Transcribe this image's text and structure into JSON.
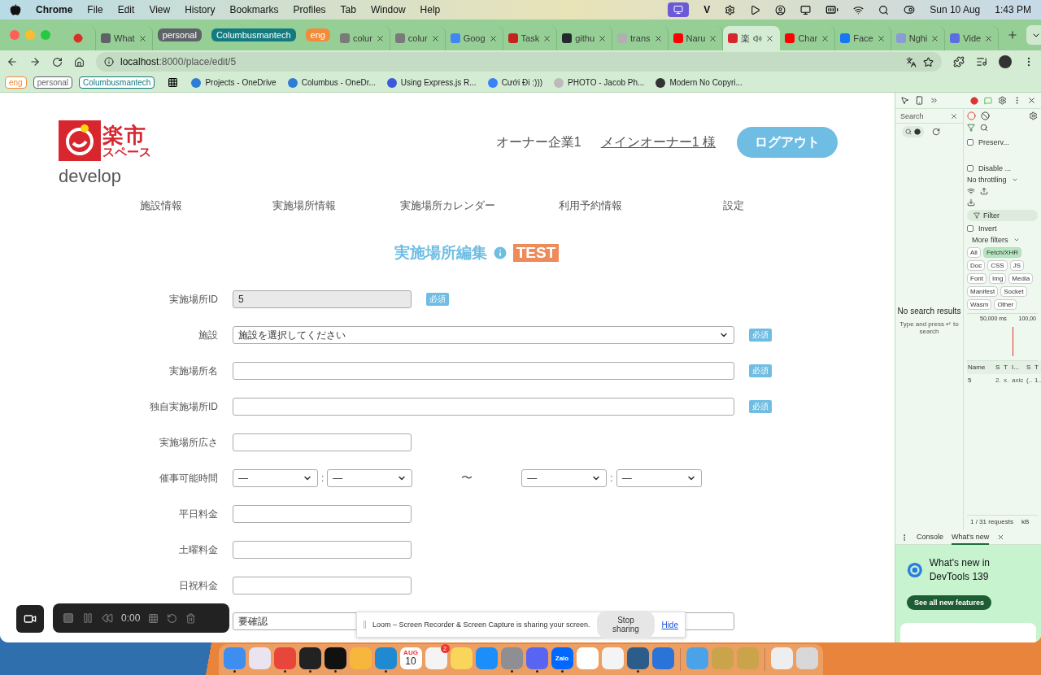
{
  "menubar": {
    "app": "Chrome",
    "menus": [
      "File",
      "Edit",
      "View",
      "History",
      "Bookmarks",
      "Profiles",
      "Tab",
      "Window",
      "Help"
    ],
    "status_letter": "V",
    "date": "Sun 10 Aug",
    "time": "1:43 PM"
  },
  "tabs": [
    {
      "kind": "pinned",
      "selected": false,
      "color": "#d93025"
    },
    {
      "kind": "tab",
      "label": "What",
      "selected": false,
      "color": "#5f6368"
    },
    {
      "kind": "group",
      "label": "personal",
      "color": "#5f6368"
    },
    {
      "kind": "group",
      "label": "Columbusmantech",
      "color": "#137a7f"
    },
    {
      "kind": "group",
      "label": "eng",
      "color": "#f28b3a"
    },
    {
      "kind": "tab",
      "label": "colur",
      "selected": false,
      "color": "#7a7a7a"
    },
    {
      "kind": "tab",
      "label": "colur",
      "selected": false,
      "color": "#7a7a7a"
    },
    {
      "kind": "tab",
      "label": "Goog",
      "selected": false,
      "color": "#4285f4"
    },
    {
      "kind": "tab",
      "label": "Task",
      "selected": false,
      "color": "#c5221f"
    },
    {
      "kind": "tab",
      "label": "githu",
      "selected": false,
      "color": "#24292f"
    },
    {
      "kind": "tab",
      "label": "trans",
      "selected": false,
      "color": "#b0b0b0"
    },
    {
      "kind": "tab",
      "label": "Naru",
      "selected": false,
      "color": "#ff0000"
    },
    {
      "kind": "tab",
      "label": "楽",
      "selected": true,
      "color": "#d7262e"
    },
    {
      "kind": "tab",
      "label": "Char",
      "selected": false,
      "color": "#ff0000"
    },
    {
      "kind": "tab",
      "label": "Face",
      "selected": false,
      "color": "#1877f2"
    },
    {
      "kind": "tab",
      "label": "Nghi",
      "selected": false,
      "color": "#8a9bd6"
    },
    {
      "kind": "tab",
      "label": "Vide",
      "selected": false,
      "color": "#5b6ee1"
    }
  ],
  "address": {
    "host": "localhost",
    "path": ":8000/place/edit/5"
  },
  "bookmarks": [
    {
      "kind": "group",
      "label": "eng",
      "color": "#f28b3a"
    },
    {
      "kind": "group",
      "label": "personal",
      "color": "#5f6368"
    },
    {
      "kind": "group",
      "label": "Columbusmantech",
      "color": "#137a7f"
    },
    {
      "kind": "link",
      "label": "Projects - OneDrive",
      "color": "#2f7dd3"
    },
    {
      "kind": "link",
      "label": "Columbus - OneDr...",
      "color": "#2f7dd3"
    },
    {
      "kind": "link",
      "label": "Using Express.js R...",
      "color": "#3b5bdb"
    },
    {
      "kind": "link",
      "label": "Cưới Đi :)))",
      "color": "#3b82f6"
    },
    {
      "kind": "link",
      "label": "PHOTO - Jacob Ph...",
      "color": "#bbbbbb"
    },
    {
      "kind": "link",
      "label": "Modern No Copyri...",
      "color": "#333333"
    }
  ],
  "page": {
    "logo": {
      "line1": "楽市",
      "line2": "スペース"
    },
    "environment": "develop",
    "company": "オーナー企業1",
    "user": "メインオーナー1 様",
    "logout": "ログアウト",
    "nav": [
      "施設情報",
      "実施場所情報",
      "実施場所カレンダー",
      "利用予約情報",
      "設定"
    ],
    "title": "実施場所編集",
    "badge": "TEST",
    "form": [
      {
        "kind": "text",
        "label": "実施場所ID",
        "value": "5",
        "disabled": true,
        "wide": false,
        "required": "必須"
      },
      {
        "kind": "select",
        "label": "施設",
        "value": "施設を選択してください",
        "wide": true,
        "required": "必須"
      },
      {
        "kind": "text",
        "label": "実施場所名",
        "wide": true,
        "required": "必須"
      },
      {
        "kind": "text",
        "label": "独自実施場所ID",
        "wide": true,
        "required": "必須"
      },
      {
        "kind": "text",
        "label": "実施場所広さ",
        "wide": false
      },
      {
        "kind": "time_range",
        "label": "催事可能時間",
        "selects": [
          "—",
          "—",
          "—",
          "—"
        ],
        "colon": ":",
        "tilde": "〜"
      },
      {
        "kind": "text",
        "label": "平日料金",
        "wide": false
      },
      {
        "kind": "text",
        "label": "土曜料金",
        "wide": false
      },
      {
        "kind": "text",
        "label": "日祝料金",
        "wide": false
      },
      {
        "kind": "pair",
        "value": "要確認"
      }
    ]
  },
  "loom": {
    "timer": "0:00",
    "notice": "Loom – Screen Recorder & Screen Capture is sharing your screen.",
    "stop": "Stop sharing",
    "hide": "Hide"
  },
  "devtools": {
    "search": {
      "title": "Search",
      "empty": "No search results",
      "hint": "Type and press ↵ to search"
    },
    "checkboxes": [
      {
        "label": "Preserv...",
        "checked": false
      },
      {
        "label": "Disable ...",
        "checked": false
      }
    ],
    "throttling": "No throttling",
    "filter": "Filter",
    "invert": {
      "label": "Invert",
      "checked": false
    },
    "more_filters": "More filters",
    "chips": [
      {
        "label": "All",
        "selected": false
      },
      {
        "label": "Fetch/XHR",
        "selected": true
      },
      {
        "label": "Doc",
        "selected": false
      },
      {
        "label": "CSS",
        "selected": false
      },
      {
        "label": "JS",
        "selected": false
      },
      {
        "label": "Font",
        "selected": false
      },
      {
        "label": "Img",
        "selected": false
      },
      {
        "label": "Media",
        "selected": false
      },
      {
        "label": "Manifest",
        "selected": false
      },
      {
        "label": "Socket",
        "selected": false
      },
      {
        "label": "Wasm",
        "selected": false
      },
      {
        "label": "Other",
        "selected": false
      }
    ],
    "ticks": [
      "50,000 ms",
      "100,00"
    ],
    "columns": [
      "Name",
      "S",
      "T",
      "I...",
      "S",
      "T"
    ],
    "rows": [
      [
        "5",
        "2.",
        "x.",
        "axic",
        "(..",
        "1.."
      ]
    ],
    "footer": [
      "1 / 31 requests",
      "kB"
    ],
    "drawer_tabs": [
      {
        "label": "Console",
        "selected": false
      },
      {
        "label": "What's new",
        "selected": true
      }
    ],
    "whats_new": "What's new in DevTools 139",
    "see_all": "See all new features"
  },
  "dock": [
    {
      "kind": "app",
      "color": "#3d8ef0",
      "running": true
    },
    {
      "kind": "app",
      "color": "#e9e4f0",
      "running": false
    },
    {
      "kind": "app",
      "color": "#e8463b",
      "running": true
    },
    {
      "kind": "app",
      "color": "#222222",
      "running": true
    },
    {
      "kind": "app",
      "color": "#111111",
      "running": true
    },
    {
      "kind": "app",
      "color": "#f6b73c",
      "running": false
    },
    {
      "kind": "app",
      "color": "#1f8ad2",
      "running": true
    },
    {
      "kind": "calendar",
      "month": "AUG",
      "day": "10",
      "running": false
    },
    {
      "kind": "badge",
      "color": "#f4f4f4",
      "badge": "2",
      "running": false
    },
    {
      "kind": "app",
      "color": "#f9d55b",
      "running": false
    },
    {
      "kind": "app",
      "color": "#1c8ef9",
      "running": false
    },
    {
      "kind": "app",
      "color": "#8e8e93",
      "running": true
    },
    {
      "kind": "app",
      "color": "#5865f2",
      "running": true
    },
    {
      "kind": "label",
      "label": "Zalo",
      "color": "#0068ff",
      "running": true
    },
    {
      "kind": "app",
      "color": "#ffffff",
      "running": false
    },
    {
      "kind": "app",
      "color": "#f4f4f4",
      "running": false
    },
    {
      "kind": "app",
      "color": "#2c5d8a",
      "running": true
    },
    {
      "kind": "app",
      "color": "#2a73d9",
      "running": false
    },
    {
      "kind": "separator"
    },
    {
      "kind": "app",
      "color": "#4aa3e8",
      "running": false
    },
    {
      "kind": "app",
      "color": "#c9a44b",
      "running": false
    },
    {
      "kind": "app",
      "color": "#c9a44b",
      "running": false
    },
    {
      "kind": "separator"
    },
    {
      "kind": "app",
      "color": "#eeeeee",
      "running": false
    },
    {
      "kind": "app",
      "color": "#d8d8d8",
      "running": false
    }
  ]
}
